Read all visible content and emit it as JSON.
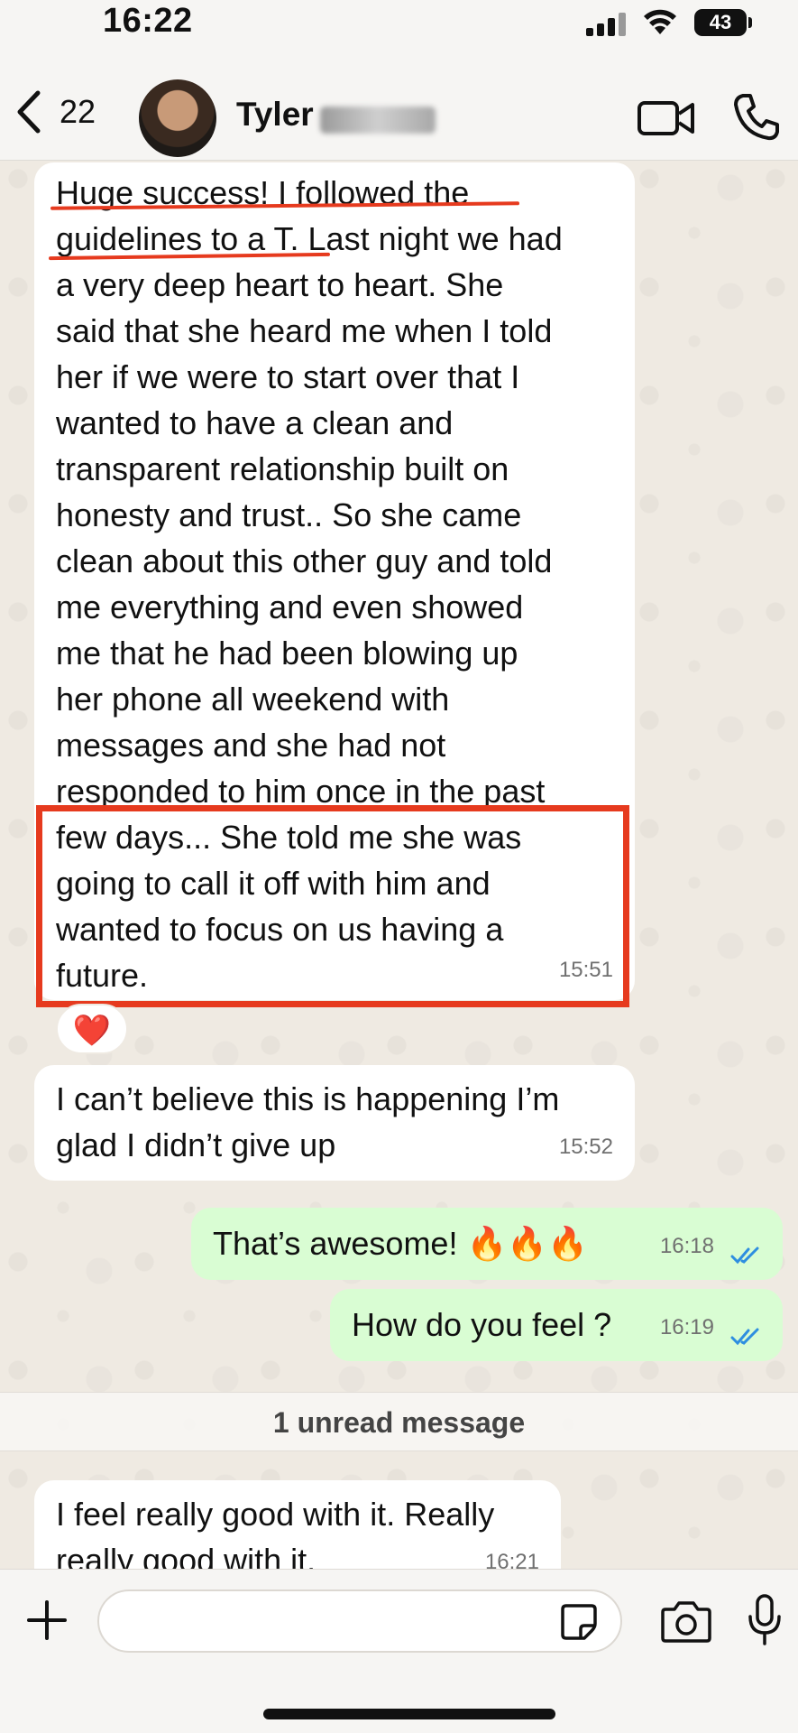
{
  "status_bar": {
    "time": "16:22",
    "battery": "43",
    "icons": [
      "signal-icon",
      "wifi-icon",
      "battery-icon"
    ]
  },
  "header": {
    "back_count": "22",
    "contact_name": "Tyler",
    "icons": [
      "chevron-left-icon",
      "video-call-icon",
      "phone-icon"
    ]
  },
  "messages": [
    {
      "direction": "incoming",
      "text": "Huge success! I followed the\nguidelines to a T. Last night we had\na very deep heart to heart. She\nsaid that she heard me when I told\nher if we were to start over that I\nwanted to have a clean and\ntransparent relationship built on\nhonesty and trust.. So she came\nclean about this other guy and told\nme everything and even showed\nme that he had been blowing up\nher phone all weekend with\nmessages and she had not\nresponded to him once in the past\nfew days... She told me she was\ngoing to call it off with him and\nwanted to focus on us having a\nfuture.",
      "time": "15:51",
      "reaction": "❤️"
    },
    {
      "direction": "incoming",
      "text": "I can’t believe this is happening I’m\nglad I didn’t give up",
      "time": "15:52"
    },
    {
      "direction": "outgoing",
      "text": "That’s awesome! 🔥🔥🔥",
      "time": "16:18",
      "status": "read"
    },
    {
      "direction": "outgoing",
      "text": "How do you feel ?",
      "time": "16:19",
      "status": "read"
    },
    {
      "direction": "incoming",
      "text": "I feel really good with it. Really\nreally good with it.",
      "time": "16:21"
    }
  ],
  "unread_banner": "1 unread message",
  "composer": {
    "placeholder": "",
    "icons": [
      "plus-icon",
      "sticker-icon",
      "camera-icon",
      "microphone-icon"
    ]
  },
  "colors": {
    "incoming_bubble": "#ffffff",
    "outgoing_bubble": "#d9fdd3",
    "read_ticks": "#2e8ee0",
    "annotation_red": "#e63a1e",
    "wallpaper": "#efeae2"
  }
}
